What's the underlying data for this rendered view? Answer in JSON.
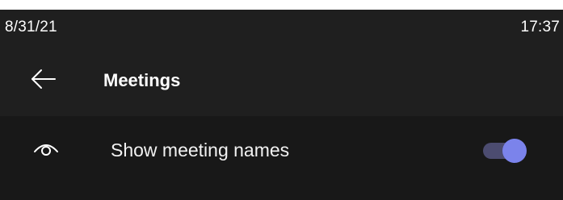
{
  "status_bar": {
    "date": "8/31/21",
    "time": "17:37"
  },
  "header": {
    "title": "Meetings",
    "back_icon": "arrow-left-icon"
  },
  "settings": {
    "rows": [
      {
        "icon": "eye-icon",
        "label": "Show meeting names",
        "toggle_on": true
      }
    ]
  },
  "colors": {
    "background": "#1f1f1f",
    "row_background": "#181818",
    "accent": "#7b83eb",
    "toggle_track": "#4c4c70"
  }
}
